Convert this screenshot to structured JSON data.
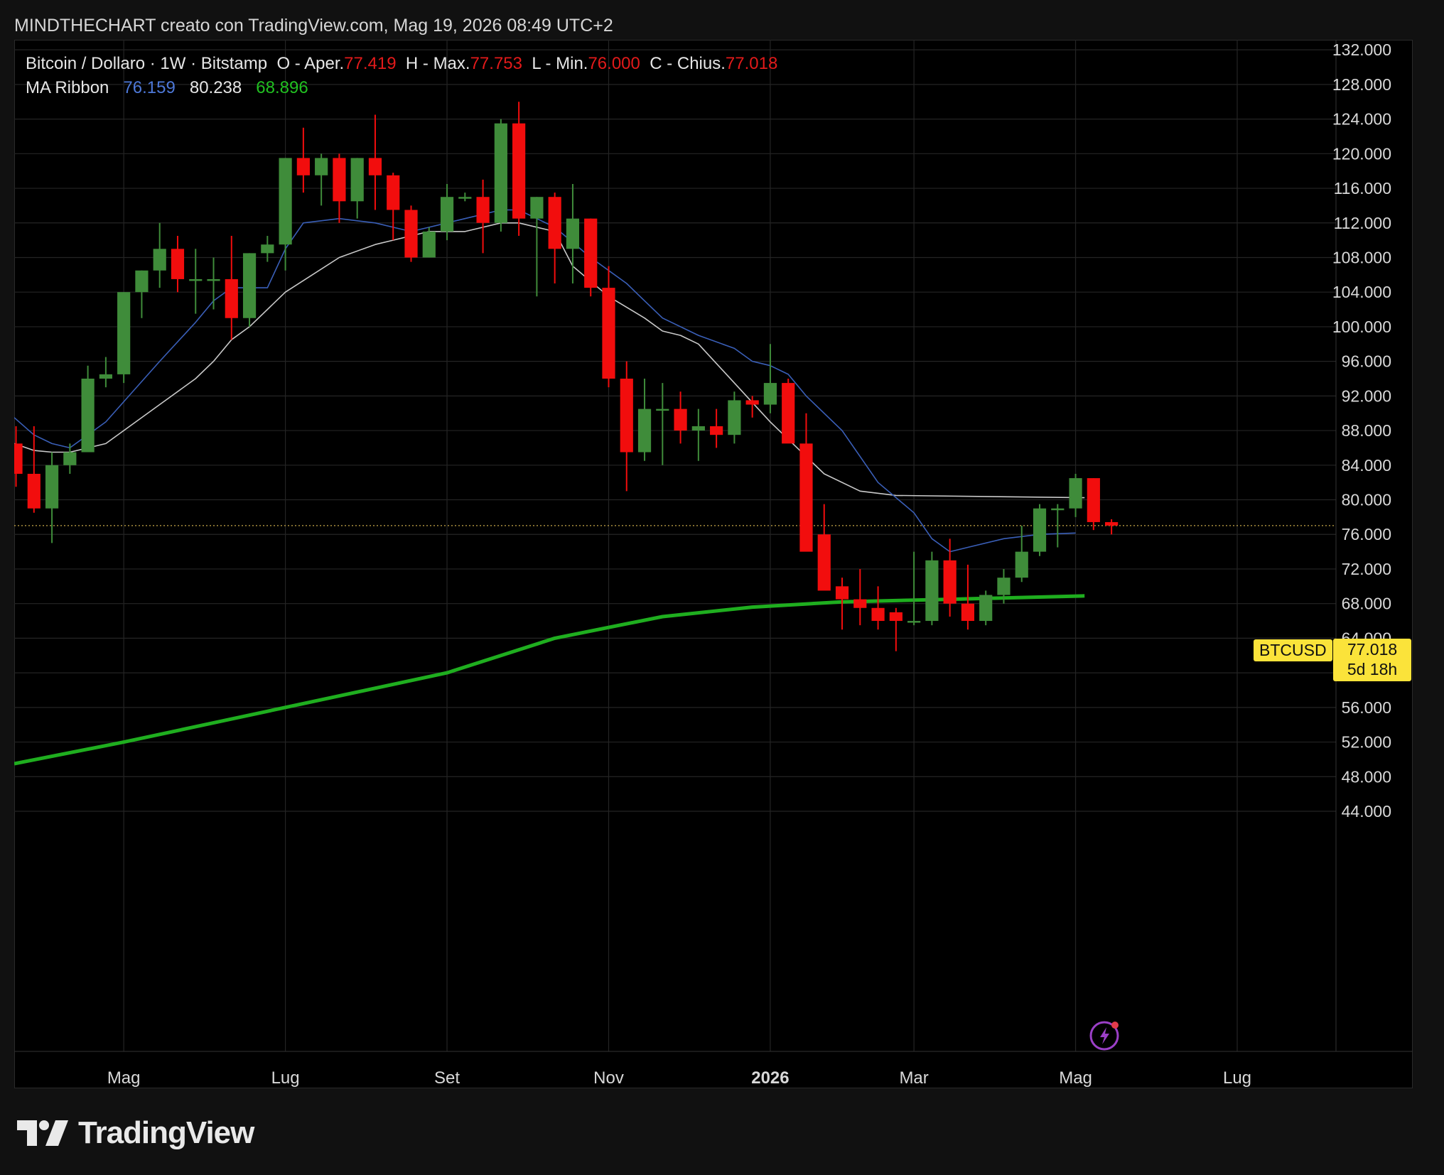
{
  "caption": "MINDTHECHART creato con TradingView.com, Mag 19, 2026 08:49 UTC+2",
  "legend": {
    "symbol": "Bitcoin / Dollaro · 1W · Bitstamp",
    "open_label": "O - Aper.",
    "open_value": "77.419",
    "high_label": "H - Max.",
    "high_value": "77.753",
    "low_label": "L - Min.",
    "low_value": "76.000",
    "close_label": "C - Chius.",
    "close_value": "77.018",
    "ma_label": "MA Ribbon",
    "ma1": "76.159",
    "ma2": "80.238",
    "ma3": "68.896"
  },
  "price_tag": {
    "symbol": "BTCUSD",
    "price": "77.018",
    "countdown": "5d 18h"
  },
  "brand": "TradingView",
  "colors": {
    "up": "#3f8c3a",
    "down": "#f20d0d",
    "ma_fast": "#3a5fb8",
    "ma_mid": "#c9c9c9",
    "ma_slow": "#1fae1f",
    "grid": "#242424"
  },
  "chart_data": {
    "type": "candlestick",
    "timeframe": "1W",
    "y_axis": {
      "min": 40000,
      "max": 136000,
      "ticks": [
        "132.000",
        "128.000",
        "124.000",
        "120.000",
        "116.000",
        "112.000",
        "108.000",
        "104.000",
        "100.000",
        "96.000",
        "92.000",
        "88.000",
        "84.000",
        "80.000",
        "76.000",
        "72.000",
        "68.000",
        "64.000",
        "60.000",
        "56.000",
        "52.000",
        "48.000",
        "44.000"
      ]
    },
    "x_axis": {
      "labels": [
        {
          "label": "Mag",
          "index": 6
        },
        {
          "label": "Lug",
          "index": 15
        },
        {
          "label": "Set",
          "index": 24
        },
        {
          "label": "Nov",
          "index": 33
        },
        {
          "label": "2026",
          "index": 42,
          "bold": true
        },
        {
          "label": "Mar",
          "index": 50
        },
        {
          "label": "Mag",
          "index": 59
        },
        {
          "label": "Lug",
          "index": 68
        }
      ],
      "index_min": -0.1,
      "index_max": 73.5
    },
    "candles": [
      [
        86500,
        88500,
        81500,
        83000
      ],
      [
        83000,
        88500,
        78500,
        79000
      ],
      [
        79000,
        85500,
        75000,
        84000
      ],
      [
        84000,
        86500,
        83000,
        85500
      ],
      [
        85500,
        95500,
        85500,
        94000
      ],
      [
        94000,
        96500,
        93000,
        94500
      ],
      [
        94500,
        104000,
        93500,
        104000
      ],
      [
        104000,
        106500,
        101000,
        106500
      ],
      [
        106500,
        112000,
        104500,
        109000
      ],
      [
        109000,
        110500,
        104000,
        105500
      ],
      [
        105500,
        109000,
        101500,
        105500
      ],
      [
        105500,
        108000,
        102000,
        105500
      ],
      [
        105500,
        110500,
        98500,
        101000
      ],
      [
        101000,
        108500,
        100000,
        108500
      ],
      [
        108500,
        110500,
        107500,
        109500
      ],
      [
        109500,
        119500,
        106500,
        119500
      ],
      [
        119500,
        123000,
        115500,
        117500
      ],
      [
        117500,
        120000,
        114000,
        119500
      ],
      [
        119500,
        120000,
        112000,
        114500
      ],
      [
        114500,
        119500,
        112500,
        119500
      ],
      [
        119500,
        124500,
        113500,
        117500
      ],
      [
        117500,
        117800,
        110000,
        113500
      ],
      [
        113500,
        114000,
        107500,
        108000
      ],
      [
        108000,
        111500,
        108000,
        111000
      ],
      [
        111000,
        116500,
        110000,
        115000
      ],
      [
        115000,
        115500,
        114500,
        115000
      ],
      [
        115000,
        117000,
        108500,
        112000
      ],
      [
        112000,
        124000,
        111000,
        123500
      ],
      [
        123500,
        126000,
        110500,
        112500
      ],
      [
        112500,
        115000,
        103500,
        115000
      ],
      [
        115000,
        115500,
        105000,
        109000
      ],
      [
        109000,
        116500,
        105000,
        112500
      ],
      [
        112500,
        112500,
        103500,
        104500
      ],
      [
        104500,
        107000,
        93000,
        94000
      ],
      [
        94000,
        96000,
        81000,
        85500
      ],
      [
        85500,
        94000,
        84500,
        90500
      ],
      [
        90500,
        93500,
        84000,
        90500
      ],
      [
        90500,
        92500,
        86500,
        88000
      ],
      [
        88000,
        90500,
        84500,
        88500
      ],
      [
        88500,
        90500,
        86000,
        87500
      ],
      [
        87500,
        92500,
        86500,
        91500
      ],
      [
        91500,
        92000,
        89500,
        91000
      ],
      [
        91000,
        98000,
        90000,
        93500
      ],
      [
        93500,
        94000,
        87500,
        86500
      ],
      [
        86500,
        90000,
        74500,
        74000
      ],
      [
        76000,
        79500,
        70000,
        69500
      ],
      [
        70000,
        71000,
        65000,
        68500
      ],
      [
        68500,
        72000,
        65500,
        67500
      ],
      [
        67500,
        70000,
        65000,
        66000
      ],
      [
        67000,
        67500,
        62500,
        66000
      ],
      [
        66000,
        74000,
        65500,
        66000
      ],
      [
        66000,
        74000,
        65500,
        73000
      ],
      [
        73000,
        75500,
        66500,
        68000
      ],
      [
        68000,
        72500,
        65000,
        66000
      ],
      [
        66000,
        69500,
        65500,
        69000
      ],
      [
        69000,
        72000,
        68000,
        71000
      ],
      [
        71000,
        77000,
        70500,
        74000
      ],
      [
        74000,
        79500,
        73500,
        79000
      ],
      [
        79000,
        79500,
        74500,
        79000
      ],
      [
        79000,
        83000,
        78000,
        82500
      ],
      [
        82500,
        82500,
        76500,
        77419
      ],
      [
        77419,
        77753,
        76000,
        77018
      ]
    ],
    "ma_fast": [
      89500,
      87500,
      86500,
      86000,
      89000,
      96000,
      100500,
      103000,
      104500,
      104500,
      104500,
      109000,
      112000,
      112500,
      112000,
      111500,
      111000,
      111500,
      112000,
      112500,
      113000,
      113500,
      113500,
      112500,
      111500,
      108000,
      105000,
      103000,
      101000,
      99000,
      97500,
      96000,
      95500,
      94500,
      92000,
      88000,
      85000,
      82000,
      78500,
      75500,
      74000,
      74500,
      75500,
      76000,
      76159
    ],
    "ma_fast_x": [
      -0.1,
      1,
      2,
      3,
      5,
      8,
      10,
      11,
      12,
      13,
      14,
      15,
      16,
      18,
      20,
      21,
      22,
      23,
      24,
      25,
      26,
      27,
      28,
      29,
      30,
      32,
      34,
      35,
      36,
      38,
      40,
      41,
      42,
      43,
      44,
      46,
      47,
      48,
      50,
      51,
      52,
      53,
      55,
      57,
      59
    ],
    "ma_mid": [
      86500,
      85700,
      85500,
      85500,
      86500,
      91000,
      94000,
      96000,
      98500,
      100000,
      104000,
      108000,
      109500,
      110000,
      111000,
      111000,
      111500,
      112000,
      112000,
      111000,
      107000,
      103500,
      101000,
      99500,
      99000,
      98000,
      93500,
      89000,
      87000,
      83000,
      81000,
      80500,
      80238
    ],
    "ma_mid_x": [
      -0.1,
      1,
      2,
      3,
      5,
      8,
      10,
      11,
      12,
      13,
      15,
      18,
      20,
      21,
      23,
      25,
      26,
      27,
      28,
      30,
      31,
      33,
      35,
      36,
      37,
      38,
      40,
      42,
      43,
      45,
      47,
      49,
      59.5
    ],
    "ma_slow": [
      49500,
      52000,
      56000,
      60000,
      64000,
      66500,
      67600,
      68200,
      68500,
      68896
    ],
    "ma_slow_x": [
      -0.1,
      6,
      15,
      24,
      30,
      36,
      41,
      46,
      52,
      59.5
    ]
  }
}
